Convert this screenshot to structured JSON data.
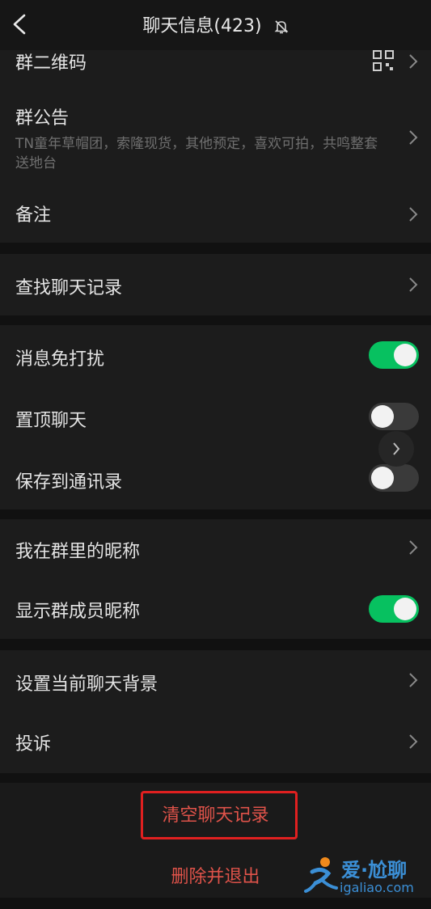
{
  "header": {
    "title": "聊天信息(423)",
    "back_icon": "chevron-left-icon",
    "mute_icon": "bell-off-icon"
  },
  "group_info": {
    "qr_code": {
      "label": "群二维码",
      "icon": "qr-code-icon"
    },
    "announcement": {
      "label": "群公告",
      "text": "TN童年草帽团，索隆现货，其他预定，喜欢可拍，共鸣整套送地台"
    },
    "remark": {
      "label": "备注"
    }
  },
  "search": {
    "label": "查找聊天记录"
  },
  "settings": {
    "mute": {
      "label": "消息免打扰",
      "on": true
    },
    "sticky": {
      "label": "置顶聊天",
      "on": false
    },
    "save_contacts": {
      "label": "保存到通讯录",
      "on": false
    }
  },
  "nickname": {
    "my_nickname": {
      "label": "我在群里的昵称"
    },
    "show_nicknames": {
      "label": "显示群成员昵称",
      "on": true
    }
  },
  "misc": {
    "background": {
      "label": "设置当前聊天背景"
    },
    "complain": {
      "label": "投诉"
    }
  },
  "actions": {
    "clear_history": "清空聊天记录",
    "delete_exit": "删除并退出"
  },
  "watermark": {
    "title": "爱·尬聊",
    "url": "igaliao.com"
  },
  "colors": {
    "accent_green": "#07c160",
    "danger_red": "#e0534a",
    "highlight_red": "#e02020"
  }
}
